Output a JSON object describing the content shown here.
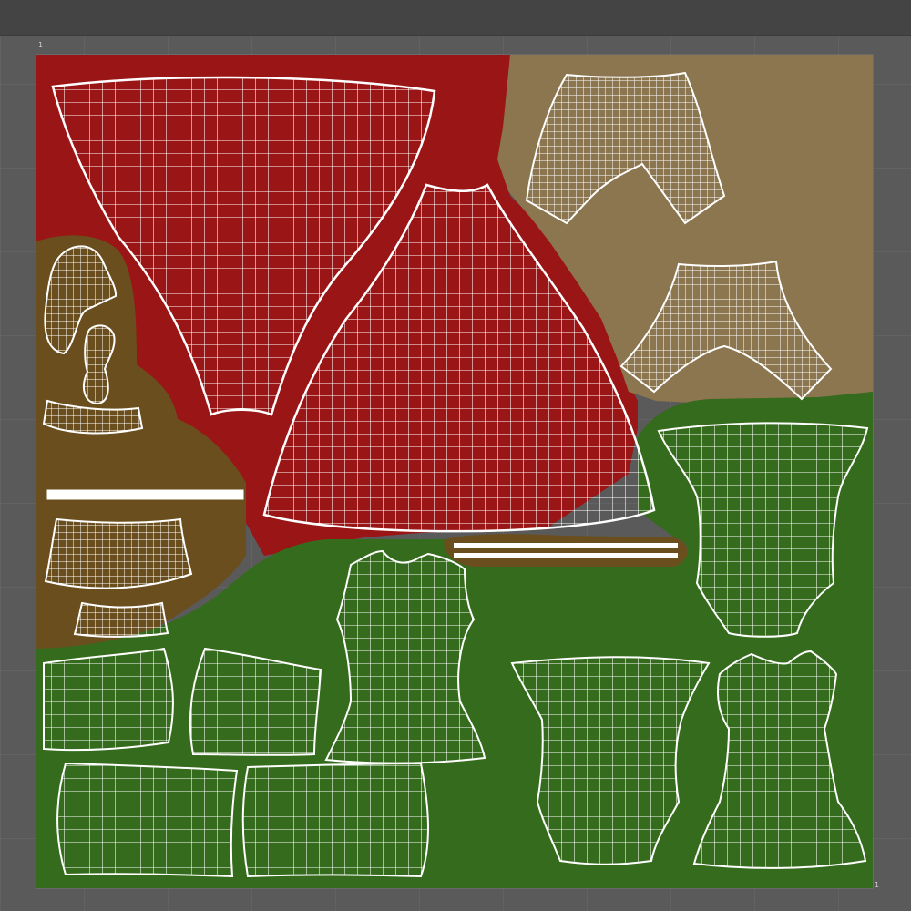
{
  "editor": {
    "view": "uv-editor",
    "corner_label_top_left": "1",
    "corner_label_bottom_right": "1"
  },
  "colors": {
    "viewport_bg": "#5a5a5a",
    "toolbar_bg": "#444444",
    "grid_line": "#6b6b6b",
    "region_red": "#9a1515",
    "region_tan": "#8c7650",
    "region_brown": "#6b4e1e",
    "region_green": "#356b1c",
    "wire": "#ffffff"
  },
  "uv_regions": [
    "red-region",
    "tan-region",
    "brown-region",
    "green-region"
  ],
  "uv_shells": [
    "skirt-upper-shell",
    "skirt-lower-shell",
    "pants-shell-top",
    "pants-shell-bottom",
    "sleeve-shell-upper",
    "collar-shell",
    "band-shell",
    "belt-strip-shell",
    "ruffle-shell",
    "ruffle-small-shell",
    "waistband-strip-shell",
    "sleeve-left-a-shell",
    "sleeve-left-b-shell",
    "sleeve-left-c-shell",
    "sleeve-left-d-shell",
    "bodice-center-shell",
    "bodice-right-top-shell",
    "bodice-right-shell",
    "bodice-far-right-shell"
  ]
}
